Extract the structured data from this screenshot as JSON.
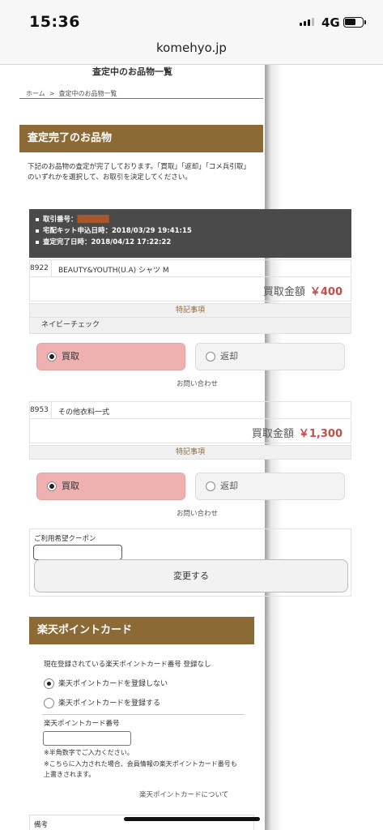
{
  "status_bar": {
    "time": "15:36",
    "network": "4G"
  },
  "browser": {
    "url": "komehyo.jp"
  },
  "page": {
    "title": "査定中のお品物一覧",
    "breadcrumb": {
      "home": "ホーム",
      "separator": ">",
      "current": "査定中のお品物一覧"
    },
    "section_title": "査定完了のお品物",
    "intro_text": "下記のお品物の査定が完了しております。「買取」「返却」「コメ兵引取」のいずれかを選択して、お取引を決定してください。",
    "transaction": {
      "number_label": "取引番号：",
      "number_value": "██████",
      "kit_label": "宅配キット申込日時：",
      "kit_value": "2018/03/29 19:41:15",
      "done_label": "査定完了日時：",
      "done_value": "2018/04/12 17:22:22"
    },
    "items": [
      {
        "code": "8922",
        "name": "BEAUTY&YOUTH(U.A) シャツ M",
        "price_label": "買取金額",
        "price": "￥400",
        "notes_label": "特記事項",
        "notes": "ネイビーチェック",
        "option_buy": "買取",
        "option_return": "返却",
        "selected": "買取",
        "inquiry": "お問い合わせ"
      },
      {
        "code": "8953",
        "name": "その他衣料一式",
        "price_label": "買取金額",
        "price": "￥1,300",
        "notes_label": "特記事項",
        "notes": "",
        "option_buy": "買取",
        "option_return": "返却",
        "selected": "買取",
        "inquiry": "お問い合わせ"
      }
    ],
    "coupon": {
      "label": "ご利用希望クーポン",
      "value": "",
      "submit": "変更する"
    },
    "rakuten": {
      "title": "楽天ポイントカード",
      "current": "現在登録されている楽天ポイントカード番号 登録なし",
      "option_no": "楽天ポイントカードを登録しない",
      "option_yes": "楽天ポイントカードを登録する",
      "selected": "楽天ポイントカードを登録しない",
      "number_label": "楽天ポイントカード番号",
      "number_value": "",
      "note1": "※半角数字でご入力ください。",
      "note2": "※こちらに入力された場合、会員情報の楽天ポイントカード番号も上書きされます。",
      "about_link": "楽天ポイントカードについて"
    },
    "remarks_label": "備考"
  },
  "colors": {
    "brand": "#8c6a36",
    "price": "#c0504d",
    "selected_option": "#eeb1b0",
    "info_box": "#4a4a4a"
  }
}
